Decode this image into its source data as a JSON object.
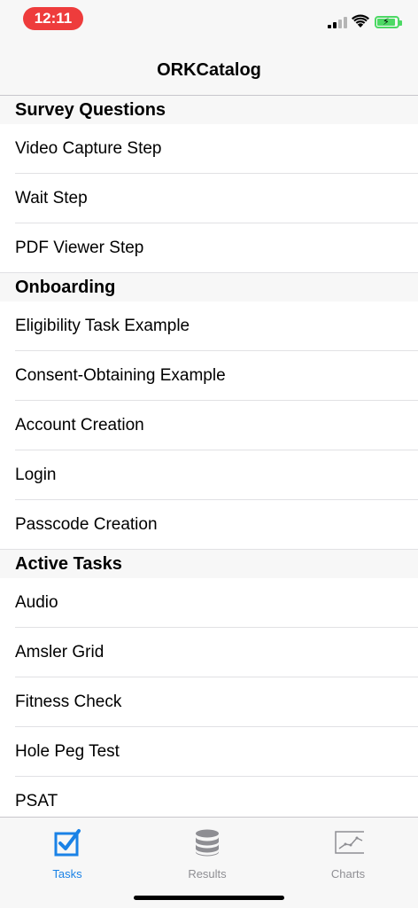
{
  "status_bar": {
    "time": "12:11"
  },
  "nav": {
    "title": "ORKCatalog"
  },
  "sections": [
    {
      "header": "Survey Questions",
      "rows": [
        "Video Capture Step",
        "Wait Step",
        "PDF Viewer Step"
      ]
    },
    {
      "header": "Onboarding",
      "rows": [
        "Eligibility Task Example",
        "Consent-Obtaining Example",
        "Account Creation",
        "Login",
        "Passcode Creation"
      ]
    },
    {
      "header": "Active Tasks",
      "rows": [
        "Audio",
        "Amsler Grid",
        "Fitness Check",
        "Hole Peg Test",
        "PSAT"
      ]
    }
  ],
  "tabs": [
    {
      "label": "Tasks",
      "icon": "checkbox-icon",
      "selected": true
    },
    {
      "label": "Results",
      "icon": "database-icon",
      "selected": false
    },
    {
      "label": "Charts",
      "icon": "chart-icon",
      "selected": false
    }
  ],
  "colors": {
    "accent": "#1a82e6",
    "inactive": "#8e8e93",
    "status_pill": "#ee3c3c",
    "battery": "#4cd964"
  }
}
